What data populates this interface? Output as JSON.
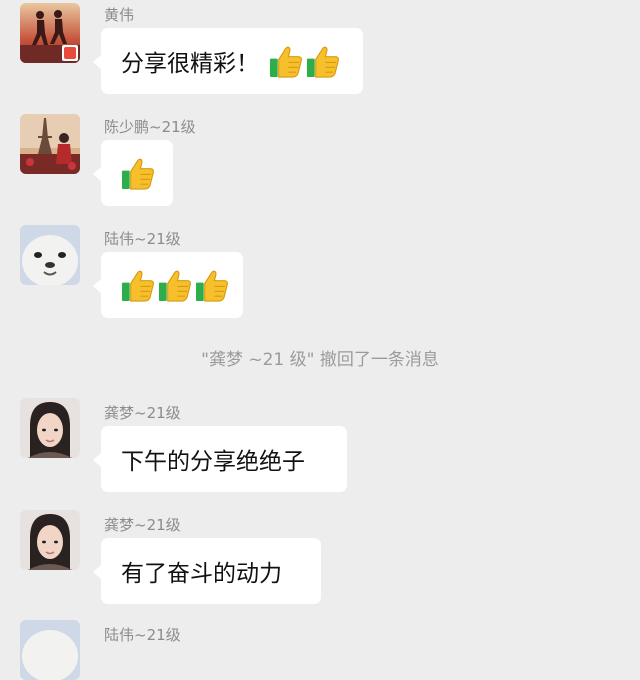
{
  "messages": [
    {
      "sender": "黄伟",
      "text": "分享很精彩！",
      "thumbs": 2,
      "avatar": "runners-avatar"
    },
    {
      "sender": "陈少鹏~21级",
      "text": "",
      "thumbs": 1,
      "avatar": "paris-avatar"
    },
    {
      "sender": "陆伟~21级",
      "text": "",
      "thumbs": 3,
      "avatar": "seal-avatar"
    },
    {
      "sender": "龚梦~21级",
      "text": "下午的分享绝绝子",
      "thumbs": 0,
      "avatar": "woman-avatar"
    },
    {
      "sender": "龚梦~21级",
      "text": "有了奋斗的动力",
      "thumbs": 0,
      "avatar": "woman-avatar"
    },
    {
      "sender": "陆伟~21级",
      "text": "",
      "thumbs": 0,
      "avatar": "seal-avatar"
    }
  ],
  "system_notice": "\"龚梦 ~21 级\" 撤回了一条消息",
  "colors": {
    "background": "#ededed",
    "bubble": "#ffffff",
    "sender": "#8c8c8c",
    "system": "#9b9b9b"
  }
}
